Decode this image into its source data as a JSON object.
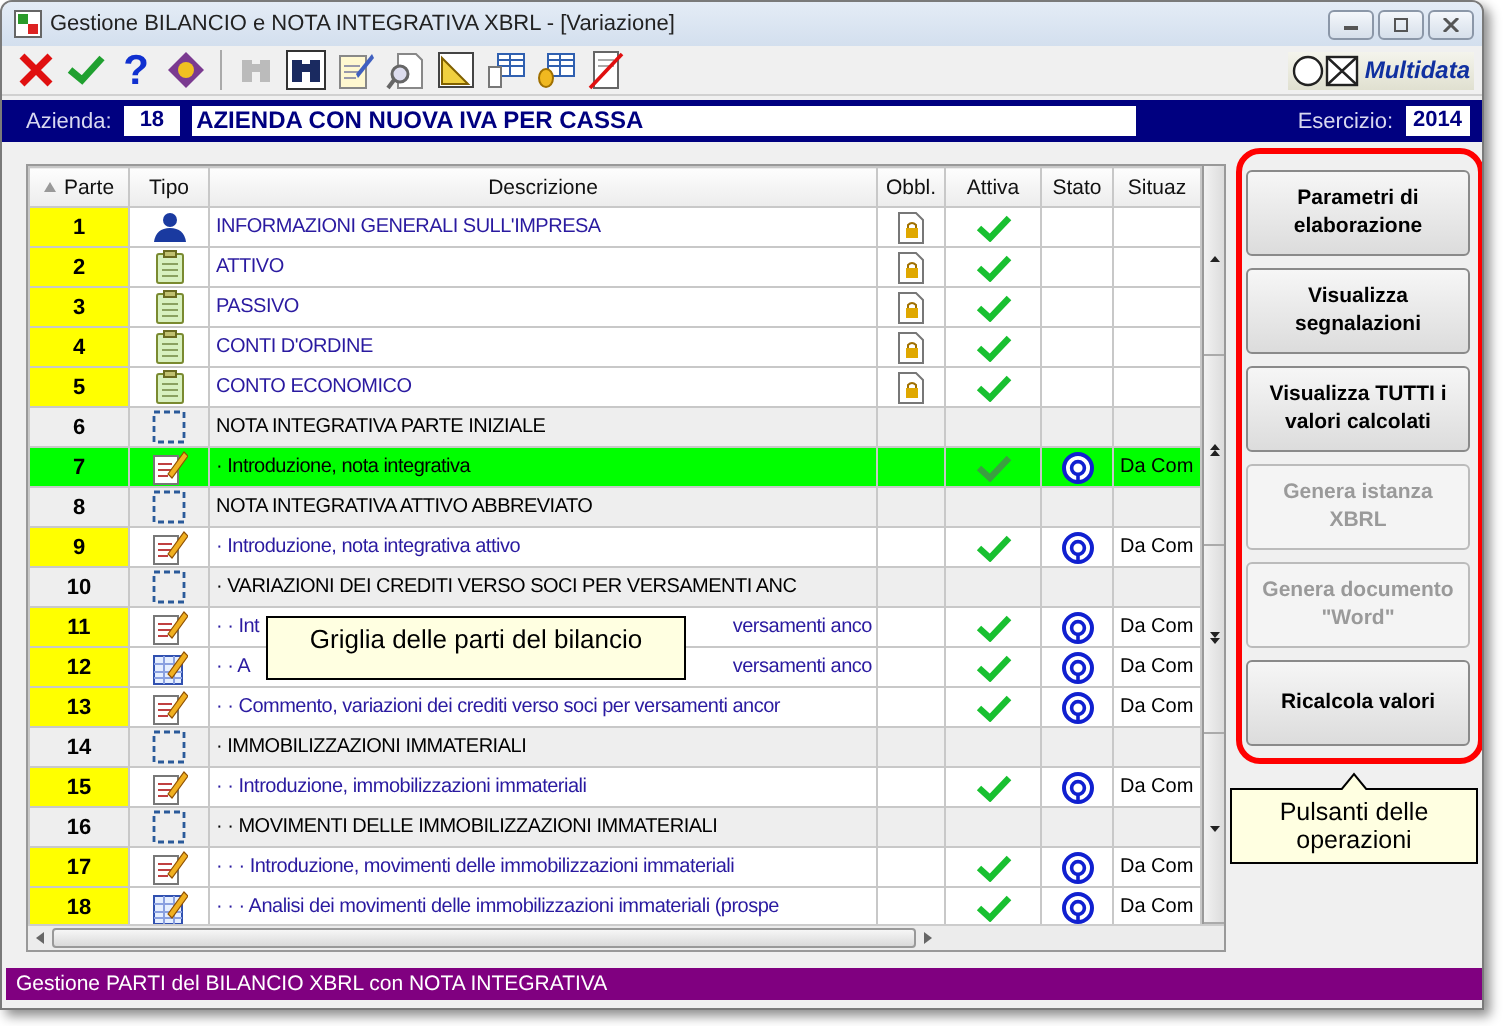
{
  "window": {
    "title": "Gestione BILANCIO e NOTA INTEGRATIVA XBRL - [Variazione]"
  },
  "toolbar": [
    {
      "kind": "cancel",
      "disabled": false
    },
    {
      "kind": "confirm",
      "disabled": false
    },
    {
      "kind": "help",
      "label": "?",
      "disabled": false
    },
    {
      "kind": "book",
      "disabled": false
    },
    {
      "kind": "binoculars",
      "disabled": true
    },
    {
      "kind": "binoculars-framed",
      "disabled": false
    },
    {
      "kind": "notepad",
      "disabled": false
    },
    {
      "kind": "preview",
      "disabled": false
    },
    {
      "kind": "ruler",
      "disabled": false
    },
    {
      "kind": "table",
      "disabled": false
    },
    {
      "kind": "table-db",
      "disabled": false
    },
    {
      "kind": "no-doc",
      "disabled": false
    }
  ],
  "logo": {
    "text": "Multidata"
  },
  "header": {
    "company_label": "Azienda:",
    "company_code": "18",
    "company_name": "AZIENDA CON NUOVA IVA PER CASSA",
    "year_label": "Esercizio:",
    "year": "2014"
  },
  "table": {
    "columns": [
      "Parte",
      "Tipo",
      "Descrizione",
      "Obbl.",
      "Attiva",
      "Stato",
      "Situaz"
    ],
    "rows": [
      {
        "parte": "1",
        "kind": "person",
        "description": "INFORMAZIONI GENERALI SULL'IMPRESA",
        "obbligatoria": true,
        "attiva": true,
        "stato": false,
        "selected": false
      },
      {
        "parte": "2",
        "kind": "clipboard",
        "description": "ATTIVO",
        "obbligatoria": true,
        "attiva": true,
        "stato": false,
        "selected": false
      },
      {
        "parte": "3",
        "kind": "clipboard",
        "description": "PASSIVO",
        "obbligatoria": true,
        "attiva": true,
        "stato": false,
        "selected": false
      },
      {
        "parte": "4",
        "kind": "clipboard",
        "description": "CONTI D'ORDINE",
        "obbligatoria": true,
        "attiva": true,
        "stato": false,
        "selected": false
      },
      {
        "parte": "5",
        "kind": "clipboard",
        "description": "CONTO ECONOMICO",
        "obbligatoria": true,
        "attiva": true,
        "stato": false,
        "selected": false
      },
      {
        "parte": "6",
        "kind": "section",
        "description": "NOTA INTEGRATIVA PARTE INIZIALE",
        "obbligatoria": false,
        "attiva": false,
        "stato": false,
        "selected": false
      },
      {
        "parte": "7",
        "kind": "note",
        "description": "· Introduzione, nota integrativa",
        "obbligatoria": false,
        "attiva": true,
        "stato": true,
        "situazione": "Da Com",
        "selected": true
      },
      {
        "parte": "8",
        "kind": "section",
        "description": "NOTA INTEGRATIVA ATTIVO ABBREVIATO",
        "obbligatoria": false,
        "attiva": false,
        "stato": false,
        "selected": false
      },
      {
        "parte": "9",
        "kind": "note",
        "description": "· Introduzione, nota integrativa attivo",
        "obbligatoria": false,
        "attiva": true,
        "stato": true,
        "situazione": "Da Com",
        "selected": false
      },
      {
        "parte": "10",
        "kind": "section",
        "description": "· VARIAZIONI DEI CREDITI VERSO SOCI PER VERSAMENTI ANC",
        "obbligatoria": false,
        "attiva": false,
        "stato": false,
        "selected": false
      },
      {
        "parte": "11",
        "kind": "note",
        "description_parts": [
          "· · Int",
          "versamenti anco"
        ],
        "obbligatoria": false,
        "attiva": true,
        "stato": true,
        "situazione": "Da Com",
        "selected": false
      },
      {
        "parte": "12",
        "kind": "sheet",
        "description_parts": [
          "· · A",
          "versamenti anco"
        ],
        "obbligatoria": false,
        "attiva": true,
        "stato": true,
        "situazione": "Da Com",
        "selected": false
      },
      {
        "parte": "13",
        "kind": "note",
        "description": "· · Commento, variazioni dei crediti verso soci per versamenti ancor",
        "obbligatoria": false,
        "attiva": true,
        "stato": true,
        "situazione": "Da Com",
        "selected": false
      },
      {
        "parte": "14",
        "kind": "section",
        "description": "· IMMOBILIZZAZIONI IMMATERIALI",
        "obbligatoria": false,
        "attiva": false,
        "stato": false,
        "selected": false
      },
      {
        "parte": "15",
        "kind": "note",
        "description": "· · Introduzione, immobilizzazioni immateriali",
        "obbligatoria": false,
        "attiva": true,
        "stato": true,
        "situazione": "Da Com",
        "selected": false
      },
      {
        "parte": "16",
        "kind": "section",
        "description": "· · MOVIMENTI DELLE IMMOBILIZZAZIONI IMMATERIALI",
        "obbligatoria": false,
        "attiva": false,
        "stato": false,
        "selected": false
      },
      {
        "parte": "17",
        "kind": "note",
        "description": "· · · Introduzione, movimenti delle immobilizzazioni immateriali",
        "obbligatoria": false,
        "attiva": true,
        "stato": true,
        "situazione": "Da Com",
        "selected": false
      },
      {
        "parte": "18",
        "kind": "sheet",
        "description": "· · · Analisi dei movimenti delle immobilizzazioni immateriali (prospe",
        "obbligatoria": false,
        "attiva": true,
        "stato": true,
        "situazione": "Da Com",
        "selected": false
      }
    ]
  },
  "grid_callout": {
    "text": "Griglia delle parti del bilancio"
  },
  "buttons": [
    {
      "label": "Parametri di elaborazione",
      "disabled": false
    },
    {
      "label": "Visualizza segnalazioni",
      "disabled": false
    },
    {
      "label": "Visualizza TUTTI i valori calcolati",
      "disabled": false
    },
    {
      "label": "Genera istanza XBRL",
      "disabled": true
    },
    {
      "label": "Genera documento \"Word\"",
      "disabled": true
    },
    {
      "label": "Ricalcola valori",
      "disabled": false
    }
  ],
  "buttons_callout": {
    "text": "Pulsanti delle operazioni"
  },
  "status_bar": {
    "text": "Gestione PARTI del BILANCIO XBRL con NOTA INTEGRATIVA"
  }
}
